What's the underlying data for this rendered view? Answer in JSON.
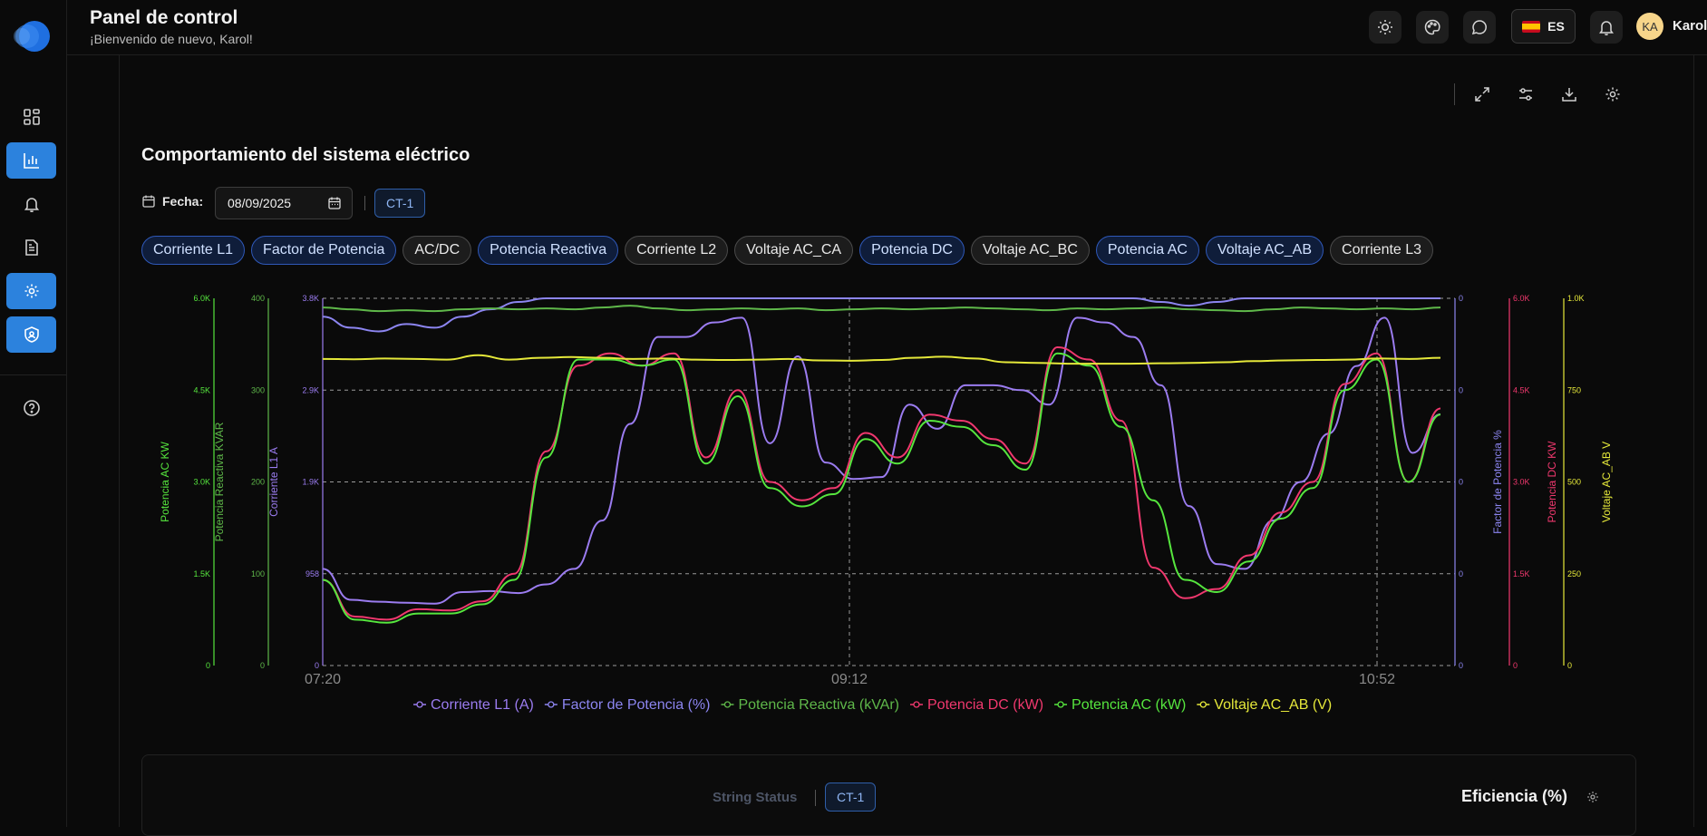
{
  "header": {
    "title": "Panel de control",
    "welcome": "¡Bienvenido de nuevo, Karol!"
  },
  "topbar": {
    "lang": "ES",
    "user_initials": "KA",
    "user_name": "Karol"
  },
  "section": {
    "title": "Comportamiento del sistema eléctrico",
    "date_label": "Fecha:",
    "date_value": "08/09/2025",
    "ct_badge": "CT-1"
  },
  "chips": [
    {
      "label": "Corriente L1",
      "active": true
    },
    {
      "label": "Factor de Potencia",
      "active": true
    },
    {
      "label": "AC/DC",
      "active": false
    },
    {
      "label": "Potencia Reactiva",
      "active": true
    },
    {
      "label": "Corriente L2",
      "active": false
    },
    {
      "label": "Voltaje AC_CA",
      "active": false
    },
    {
      "label": "Potencia DC",
      "active": true
    },
    {
      "label": "Voltaje AC_BC",
      "active": false
    },
    {
      "label": "Potencia AC",
      "active": true
    },
    {
      "label": "Voltaje AC_AB",
      "active": true
    },
    {
      "label": "Corriente L3",
      "active": false
    }
  ],
  "bottom": {
    "string_status": "String Status",
    "ct_badge": "CT-1",
    "efficiency_title": "Eficiencia (%)"
  },
  "colors": {
    "accent": "#2c82dd",
    "corriente": "#9b7cf0",
    "factor": "#8c85f0",
    "reactiva": "#5fb84a",
    "dc": "#f0386e",
    "ac": "#56e63e",
    "voltaje": "#e5e83a"
  },
  "chart_data": {
    "type": "line",
    "x_ticks": [
      "07:20",
      "09:12",
      "10:52"
    ],
    "y_axes": [
      {
        "label": "Potencia AC KW",
        "ticks": [
          "0",
          "1.5K",
          "3.0K",
          "4.5K",
          "6.0K"
        ],
        "range": [
          0,
          6000
        ],
        "color": "#56e63e"
      },
      {
        "label": "Potencia Reactiva KVAR",
        "ticks": [
          "0",
          "100",
          "200",
          "300",
          "400"
        ],
        "range": [
          0,
          400
        ],
        "color": "#5fb84a"
      },
      {
        "label": "Corriente L1 A",
        "ticks": [
          "0",
          "958",
          "1.9K",
          "2.9K",
          "3.8K"
        ],
        "range": [
          0,
          3800
        ],
        "color": "#9b7cf0"
      },
      {
        "label": "Factor de Potencia %",
        "ticks": [
          "0",
          "0",
          "0",
          "0",
          "0"
        ],
        "range": [
          0,
          1
        ],
        "color": "#8c85f0"
      },
      {
        "label": "Potencia DC KW",
        "ticks": [
          "0",
          "1.5K",
          "3.0K",
          "4.5K",
          "6.0K"
        ],
        "range": [
          0,
          6000
        ],
        "color": "#f0386e"
      },
      {
        "label": "Voltaje AC_AB V",
        "ticks": [
          "0",
          "250",
          "500",
          "750",
          "1.0K"
        ],
        "range": [
          0,
          1000
        ],
        "color": "#e5e83a"
      }
    ],
    "series": [
      {
        "name": "Corriente L1 (A)",
        "color": "#9b7cf0",
        "values": [
          1000,
          680,
          660,
          650,
          640,
          760,
          770,
          750,
          840,
          1000,
          1500,
          2500,
          3400,
          3400,
          3550,
          3600,
          2300,
          3200,
          2100,
          1930,
          1950,
          2700,
          2450,
          2900,
          2900,
          2850,
          2700,
          3600,
          3550,
          3400,
          2900,
          1650,
          1050,
          1000,
          1500,
          1900,
          2400,
          3100,
          3600,
          2200,
          2600
        ]
      },
      {
        "name": "Factor de Potencia (%)",
        "color": "#8c85f0",
        "values": [
          0.95,
          0.92,
          0.91,
          0.93,
          0.92,
          0.95,
          0.97,
          0.99,
          1.0,
          1.0,
          1.0,
          1.0,
          1.0,
          1.0,
          1.0,
          1.0,
          1.0,
          1.0,
          1.0,
          1.0,
          1.0,
          1.0,
          1.0,
          1.0,
          1.0,
          1.0,
          1.0,
          1.0,
          1.0,
          1.0,
          0.99,
          0.98,
          0.99,
          1.0,
          1.0,
          1.0,
          1.0,
          1.0,
          1.0,
          1.0,
          1.0
        ]
      },
      {
        "name": "Potencia Reactiva (kVAr)",
        "color": "#5fb84a",
        "values": [
          390,
          388,
          386,
          387,
          386,
          388,
          389,
          388,
          389,
          388,
          390,
          392,
          389,
          387,
          388,
          389,
          388,
          389,
          387,
          388,
          389,
          388,
          389,
          390,
          389,
          388,
          387,
          389,
          388,
          389,
          390,
          388,
          387,
          386,
          388,
          390,
          389,
          388,
          389,
          388,
          390
        ]
      },
      {
        "name": "Potencia DC (kW)",
        "color": "#f0386e",
        "values": [
          1400,
          800,
          750,
          920,
          900,
          1050,
          1500,
          3500,
          4900,
          5100,
          4900,
          5100,
          3400,
          4500,
          3000,
          2700,
          2900,
          3800,
          3400,
          4100,
          4000,
          3700,
          3300,
          5200,
          5000,
          4000,
          1600,
          1100,
          1250,
          1800,
          2500,
          3000,
          4600,
          5100,
          3000,
          4200
        ]
      },
      {
        "name": "Potencia AC (kW)",
        "color": "#56e63e",
        "values": [
          1400,
          750,
          700,
          850,
          850,
          1000,
          1400,
          3400,
          5000,
          5000,
          4900,
          5000,
          3300,
          4400,
          2900,
          2600,
          2800,
          3700,
          3300,
          4000,
          3900,
          3600,
          3200,
          5100,
          4900,
          3900,
          2700,
          1400,
          1200,
          1700,
          2400,
          2900,
          4500,
          5000,
          3000,
          4100
        ]
      },
      {
        "name": "Voltaje AC_AB (V)",
        "color": "#e5e83a",
        "values": [
          835,
          834,
          836,
          835,
          833,
          845,
          833,
          838,
          840,
          838,
          835,
          836,
          833,
          832,
          833,
          835,
          831,
          830,
          832,
          838,
          841,
          836,
          826,
          824,
          822,
          822,
          822,
          823,
          824,
          826,
          829,
          831,
          832,
          833,
          836,
          835,
          838
        ]
      }
    ]
  }
}
